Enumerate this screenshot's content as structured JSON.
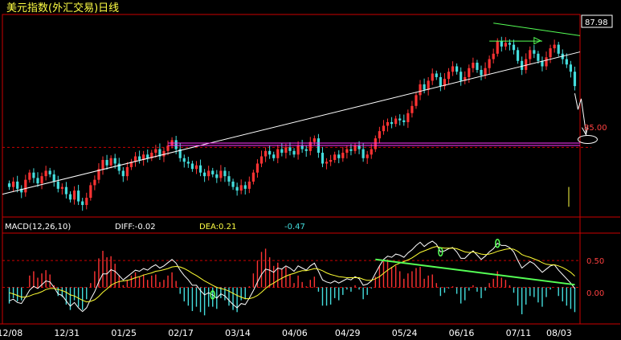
{
  "title": "美元指数(外汇交易)日线",
  "colors": {
    "background": "#000000",
    "frame": "#cc0000",
    "up_candle": "#ff3333",
    "down_candle": "#44dddd",
    "title": "#ffff44",
    "trend_line": "#ffffff",
    "horizontal_line": "#ff33ff",
    "green_line": "#55ff55",
    "diff_line": "#ffffff",
    "dea_line": "#ffff33",
    "tick_text": "#ff4040"
  },
  "price_panel": {
    "current_price_label": "87.98",
    "level_label": "85.00",
    "ylim": [
      83.2,
      88.6
    ]
  },
  "macd_panel": {
    "label": "MACD(12,26,10)",
    "diff_label": "DIFF:-0.02",
    "dea_label": "DEA:0.21",
    "macd_value_label": "-0.47",
    "ticks": [
      "0.50",
      "0.00"
    ],
    "ylim": [
      -0.62,
      0.95
    ]
  },
  "x_axis": {
    "labels": [
      "12/08",
      "12/31",
      "01/25",
      "02/17",
      "03/14",
      "04/06",
      "04/29",
      "05/24",
      "06/16",
      "07/11",
      "08/03"
    ]
  },
  "chart_data": {
    "type": "candlestick",
    "title": "美元指数(外汇交易)日线",
    "x_tick_labels": [
      "12/08",
      "12/31",
      "01/25",
      "02/17",
      "03/14",
      "04/06",
      "04/29",
      "05/24",
      "06/16",
      "07/11",
      "08/03"
    ],
    "close": [
      83.9,
      84.05,
      83.85,
      83.75,
      84.1,
      84.3,
      84.15,
      84.0,
      84.2,
      84.35,
      84.25,
      84.05,
      83.85,
      83.9,
      83.7,
      83.55,
      83.8,
      83.5,
      83.4,
      83.6,
      83.95,
      84.1,
      84.4,
      84.65,
      84.5,
      84.7,
      84.55,
      84.35,
      84.2,
      84.45,
      84.6,
      84.75,
      84.65,
      84.8,
      84.7,
      84.85,
      84.95,
      84.75,
      84.9,
      85.05,
      85.2,
      84.95,
      84.7,
      84.6,
      84.55,
      84.4,
      84.5,
      84.3,
      84.2,
      84.35,
      84.25,
      84.15,
      84.35,
      84.2,
      84.05,
      83.9,
      83.8,
      83.95,
      83.85,
      84.05,
      84.3,
      84.55,
      84.75,
      84.9,
      84.8,
      84.7,
      84.95,
      84.85,
      85.0,
      84.9,
      84.8,
      85.05,
      84.95,
      84.9,
      85.15,
      85.25,
      84.85,
      84.55,
      84.6,
      84.65,
      84.8,
      84.7,
      84.85,
      84.95,
      84.9,
      85.05,
      84.95,
      84.7,
      84.8,
      84.95,
      85.25,
      85.45,
      85.6,
      85.7,
      85.65,
      85.8,
      85.75,
      85.7,
      85.95,
      86.15,
      86.45,
      86.75,
      86.6,
      86.85,
      87.05,
      86.95,
      86.7,
      86.9,
      87.1,
      87.25,
      87.1,
      86.85,
      86.95,
      87.2,
      87.35,
      87.15,
      87.0,
      87.2,
      87.45,
      87.6,
      87.95,
      87.8,
      87.9,
      87.85,
      87.7,
      87.4,
      87.15,
      87.45,
      87.7,
      87.6,
      87.4,
      87.25,
      87.5,
      87.75,
      87.85,
      87.6,
      87.45,
      87.3,
      87.1,
      86.7
    ],
    "horizontal_line_level": 85.12,
    "macd": {
      "params": "12,26,10",
      "diff_last": -0.02,
      "dea_last": 0.21,
      "macd_last": -0.47,
      "diff": [
        -0.25,
        -0.22,
        -0.28,
        -0.3,
        -0.18,
        -0.05,
        0.02,
        -0.02,
        0.05,
        0.12,
        0.1,
        0.0,
        -0.12,
        -0.15,
        -0.25,
        -0.35,
        -0.28,
        -0.38,
        -0.45,
        -0.38,
        -0.22,
        -0.08,
        0.1,
        0.25,
        0.25,
        0.33,
        0.3,
        0.22,
        0.14,
        0.2,
        0.26,
        0.32,
        0.3,
        0.35,
        0.32,
        0.38,
        0.42,
        0.36,
        0.4,
        0.46,
        0.52,
        0.45,
        0.32,
        0.22,
        0.14,
        0.04,
        0.04,
        -0.06,
        -0.14,
        -0.1,
        -0.14,
        -0.2,
        -0.12,
        -0.16,
        -0.24,
        -0.32,
        -0.38,
        -0.3,
        -0.32,
        -0.2,
        -0.06,
        0.1,
        0.24,
        0.34,
        0.32,
        0.28,
        0.36,
        0.34,
        0.4,
        0.36,
        0.3,
        0.4,
        0.36,
        0.32,
        0.4,
        0.45,
        0.3,
        0.14,
        0.1,
        0.08,
        0.12,
        0.08,
        0.12,
        0.16,
        0.14,
        0.2,
        0.16,
        0.04,
        0.06,
        0.12,
        0.26,
        0.4,
        0.52,
        0.58,
        0.56,
        0.62,
        0.6,
        0.56,
        0.64,
        0.7,
        0.78,
        0.84,
        0.76,
        0.82,
        0.86,
        0.8,
        0.66,
        0.68,
        0.72,
        0.74,
        0.66,
        0.54,
        0.54,
        0.62,
        0.68,
        0.6,
        0.52,
        0.58,
        0.66,
        0.72,
        0.82,
        0.78,
        0.78,
        0.74,
        0.66,
        0.5,
        0.36,
        0.42,
        0.48,
        0.44,
        0.36,
        0.28,
        0.34,
        0.4,
        0.42,
        0.32,
        0.24,
        0.16,
        0.08,
        -0.02
      ],
      "dea": [
        -0.1,
        -0.12,
        -0.15,
        -0.18,
        -0.18,
        -0.16,
        -0.13,
        -0.11,
        -0.08,
        -0.04,
        -0.02,
        -0.02,
        -0.04,
        -0.06,
        -0.09,
        -0.14,
        -0.16,
        -0.2,
        -0.24,
        -0.27,
        -0.26,
        -0.23,
        -0.17,
        -0.09,
        -0.03,
        0.04,
        0.08,
        0.11,
        0.12,
        0.13,
        0.15,
        0.18,
        0.2,
        0.23,
        0.25,
        0.27,
        0.3,
        0.31,
        0.33,
        0.35,
        0.38,
        0.39,
        0.38,
        0.35,
        0.31,
        0.26,
        0.22,
        0.17,
        0.12,
        0.08,
        0.04,
        0.0,
        -0.02,
        -0.04,
        -0.07,
        -0.11,
        -0.15,
        -0.18,
        -0.21,
        -0.21,
        -0.19,
        -0.15,
        -0.09,
        -0.02,
        0.04,
        0.08,
        0.13,
        0.17,
        0.21,
        0.24,
        0.26,
        0.29,
        0.31,
        0.31,
        0.33,
        0.35,
        0.34,
        0.31,
        0.27,
        0.24,
        0.22,
        0.2,
        0.19,
        0.18,
        0.18,
        0.18,
        0.18,
        0.15,
        0.13,
        0.13,
        0.16,
        0.2,
        0.26,
        0.32,
        0.37,
        0.42,
        0.45,
        0.48,
        0.51,
        0.55,
        0.6,
        0.65,
        0.68,
        0.71,
        0.74,
        0.76,
        0.74,
        0.73,
        0.73,
        0.73,
        0.72,
        0.69,
        0.66,
        0.65,
        0.66,
        0.64,
        0.62,
        0.61,
        0.62,
        0.64,
        0.67,
        0.69,
        0.71,
        0.72,
        0.71,
        0.67,
        0.61,
        0.58,
        0.56,
        0.53,
        0.5,
        0.46,
        0.43,
        0.42,
        0.42,
        0.4,
        0.37,
        0.33,
        0.28,
        0.21
      ]
    }
  }
}
